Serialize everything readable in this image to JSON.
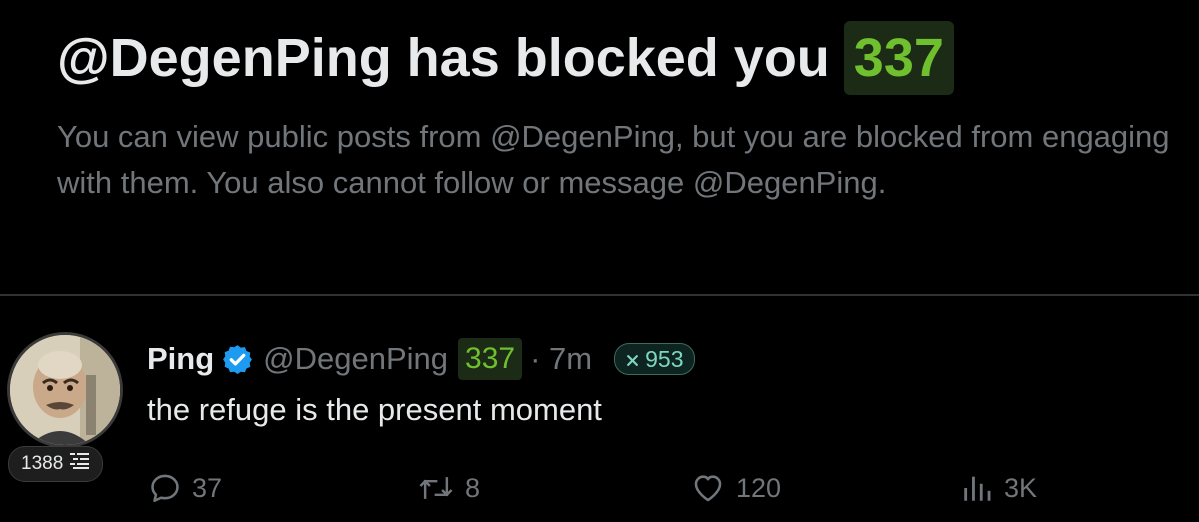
{
  "notice": {
    "title": "@DegenPing has blocked you",
    "title_score": "337",
    "body": "You can view public posts from @DegenPing, but you are blocked from engaging with them. You also cannot follow or message @DegenPing."
  },
  "tweet": {
    "display_name": "Ping",
    "handle": "@DegenPing",
    "score": "337",
    "time": "· 7m",
    "x_score": "953",
    "text": "the refuge is the present moment",
    "avatar_badge": "1388"
  },
  "actions": {
    "replies": "37",
    "reposts": "8",
    "likes": "120",
    "views": "3K"
  },
  "icons": {
    "verified": "verified-badge-icon",
    "reply": "reply-icon",
    "repost": "repost-icon",
    "like": "heart-icon",
    "views": "views-icon",
    "x_mark": "x-mark-icon",
    "list": "list-icon"
  },
  "colors": {
    "background": "#000000",
    "score_green": "#6fbf2f",
    "verified_blue": "#1d9bf0",
    "muted": "#71767b",
    "text": "#e7e9ea",
    "teal_pill": "#7fd6c0"
  }
}
